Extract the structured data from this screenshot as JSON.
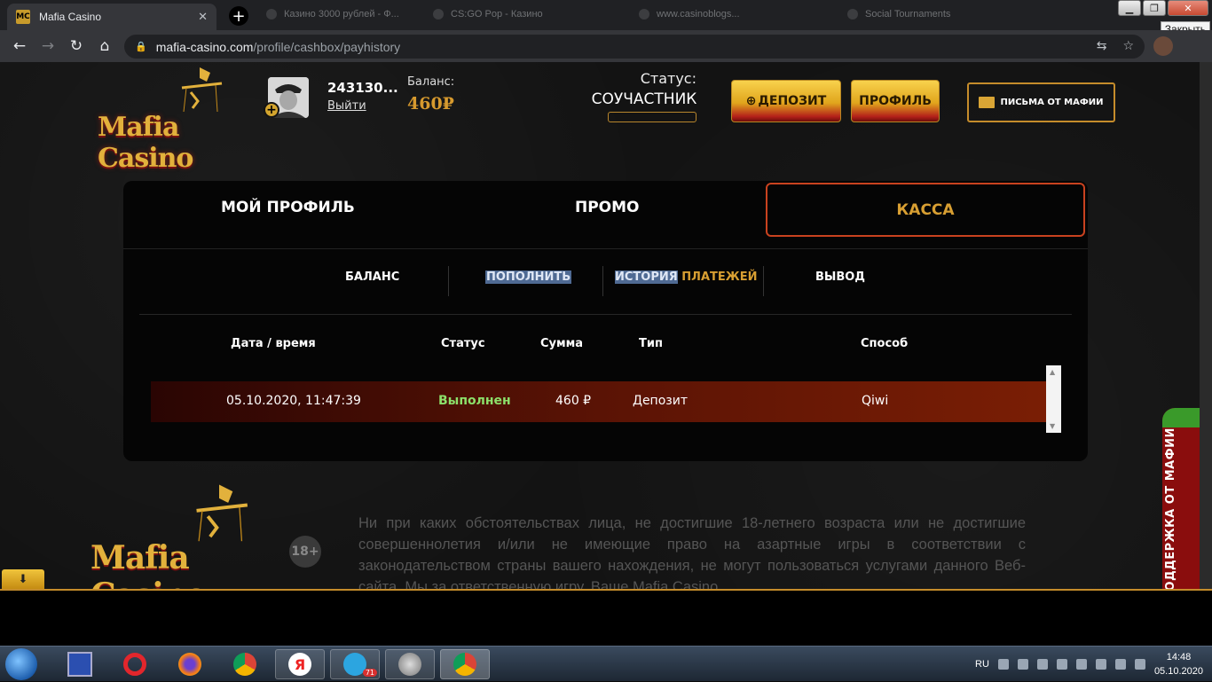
{
  "browser": {
    "active_tab": {
      "title": "Mafia Casino",
      "favicon": "MC"
    },
    "background_tabs": [
      {
        "title": "Казино 3000 рублей - Ф..."
      },
      {
        "title": "CS:GO Pop - Казино"
      },
      {
        "title": "www.casinoblogs..."
      },
      {
        "title": "Social Tournaments"
      }
    ],
    "url_host": "mafia-casino.com",
    "url_path": "/profile/cashbox/payhistory",
    "close_tooltip": "Закрыть"
  },
  "header": {
    "logo_text": "Mafia Casino",
    "user_id": "243130...",
    "logout": "Выйти",
    "balance_label": "Баланс:",
    "balance_value": "460₽",
    "status_label": "Статус:",
    "status_value": "СОУЧАСТНИК",
    "deposit_button": "ДЕПОЗИТ",
    "profile_button": "ПРОФИЛЬ",
    "mail_button": "ПИСЬМА ОТ МАФИИ"
  },
  "tabs": {
    "profile": "МОЙ ПРОФИЛЬ",
    "promo": "ПРОМО",
    "kassa": "КАССА"
  },
  "subtabs": {
    "balance": "БАЛАНС",
    "topup": "ПОПОЛНИТЬ",
    "history_a": "ИСТОРИЯ",
    "history_b": " ПЛАТЕЖЕЙ",
    "withdraw": "ВЫВОД"
  },
  "table": {
    "headers": {
      "datetime": "Дата / время",
      "status": "Статус",
      "amount": "Сумма",
      "type": "Тип",
      "method": "Способ"
    },
    "rows": [
      {
        "datetime": "05.10.2020, 11:47:39",
        "status": "Выполнен",
        "amount": "460 ₽",
        "type": "Депозит",
        "method": "Qiwi"
      }
    ]
  },
  "footer": {
    "logo_text": "Mafia Casino",
    "age": "18+",
    "disclaimer": "Ни при каких обстоятельствах лица, не достигшие 18-летнего возраста или не достигшие совершеннолетия и/или не имеющие право на азартные игры в соответствии с законодательством страны вашего нахождения, не могут пользоваться услугами данного Веб-сайта. Мы за ответственную игру. Ваше Mafia Casino",
    "support": "ПОДДЕРЖКА ОТ МАФИИ",
    "down_arrow": "⬇"
  },
  "taskbar": {
    "lang": "RU",
    "time": "14:48",
    "date": "05.10.2020",
    "telegram_badge": "71"
  },
  "colors": {
    "gold": "#d89f32",
    "accent_red": "#c9421f",
    "success": "#8ce06a"
  }
}
